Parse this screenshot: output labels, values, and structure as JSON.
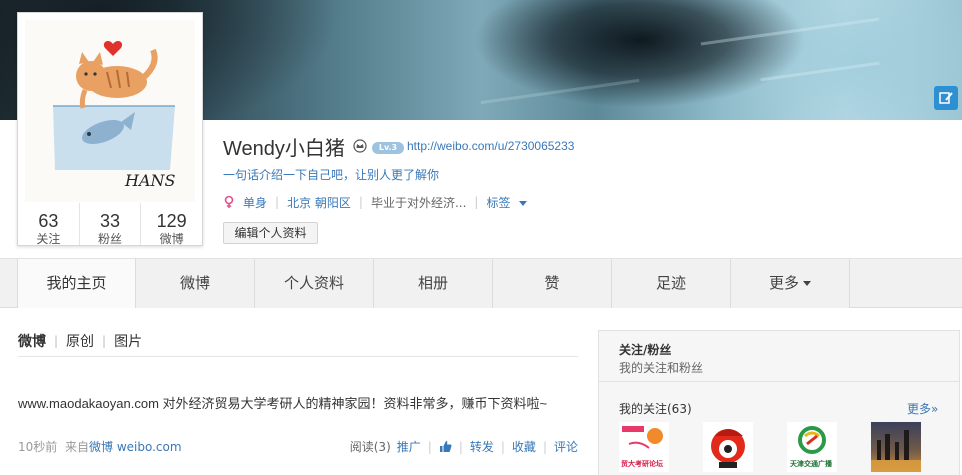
{
  "profile": {
    "name": "Wendy小白猪",
    "level": "Lv.3",
    "url": "http://weibo.com/u/2730065233",
    "bio": "一句话介绍一下自己吧，让别人更了解你",
    "gender": "单身",
    "location": "北京 朝阳区",
    "school": "毕业于对外经济...",
    "tags_label": "标签",
    "edit_button": "编辑个人资料",
    "avatar_signature": "HANS"
  },
  "stats": [
    {
      "value": "63",
      "label": "关注"
    },
    {
      "value": "33",
      "label": "粉丝"
    },
    {
      "value": "129",
      "label": "微博"
    }
  ],
  "tabs": [
    {
      "label": "我的主页"
    },
    {
      "label": "微博"
    },
    {
      "label": "个人资料"
    },
    {
      "label": "相册"
    },
    {
      "label": "赞"
    },
    {
      "label": "足迹"
    },
    {
      "label": "更多"
    }
  ],
  "feed": {
    "filters": [
      "微博",
      "原创",
      "图片"
    ],
    "post": {
      "text": "www.maodakaoyan.com 对外经济贸易大学考研人的精神家园！资料非常多，赚币下资料啦~",
      "time": "10秒前",
      "source_prefix": "来自",
      "source_link": "微博 weibo.com",
      "read": "阅读(3)",
      "promote": "推广",
      "repost": "转发",
      "favorite": "收藏",
      "comment": "评论"
    }
  },
  "sidebar": {
    "title": "关注/粉丝",
    "subtitle": "我的关注和粉丝",
    "following_label": "我的关注(63)",
    "more": "更多»",
    "thumb_captions": [
      "贸大考研论坛",
      "天津交通广播"
    ]
  },
  "colors": {
    "link": "#3978b8",
    "accent_blue": "#2f8fd3"
  }
}
